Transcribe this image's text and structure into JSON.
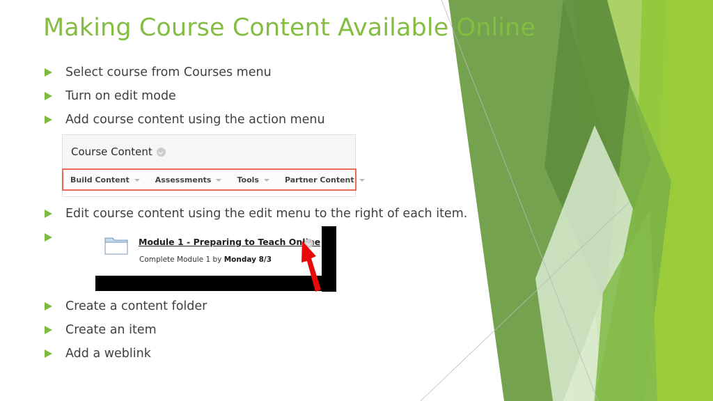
{
  "slide": {
    "title": "Making Course Content Available Online",
    "title_color": "#84BD41",
    "bullet_color": "#7DBB42",
    "text_color": "#404040",
    "background_color": "#FFFFFF"
  },
  "bullets_top": [
    {
      "label": "Select course from Courses menu"
    },
    {
      "label": "Turn on edit mode"
    },
    {
      "label": "Add course content using the action menu"
    }
  ],
  "bullets_middle": [
    {
      "label": "Edit course content using the edit menu to the right of each item."
    },
    {
      "label": ""
    }
  ],
  "bullets_bottom": [
    {
      "label": "Create a content folder"
    },
    {
      "label": "Create an item"
    },
    {
      "label": "Add a weblink"
    }
  ],
  "course_content_panel": {
    "header_title": "Course Content",
    "header_chevron_icon": "chevron-down-circle-icon",
    "highlight_color": "#ED6A5A",
    "toolbar": [
      {
        "label": "Build Content",
        "caret": true
      },
      {
        "label": "Assessments",
        "caret": true
      },
      {
        "label": "Tools",
        "caret": true
      },
      {
        "label": "Partner Content",
        "caret": true
      }
    ]
  },
  "module_item": {
    "folder_icon": "folder-icon",
    "title": "Module 1 - Preparing to Teach Online",
    "title_chevron_icon": "chevron-down-circle-icon",
    "description_prefix": "Complete Module 1 by ",
    "description_due": "Monday 8/3",
    "annotation_arrow_icon": "red-arrow-icon",
    "annotation_arrow_color": "#E8090A",
    "redaction_color": "#000000"
  }
}
